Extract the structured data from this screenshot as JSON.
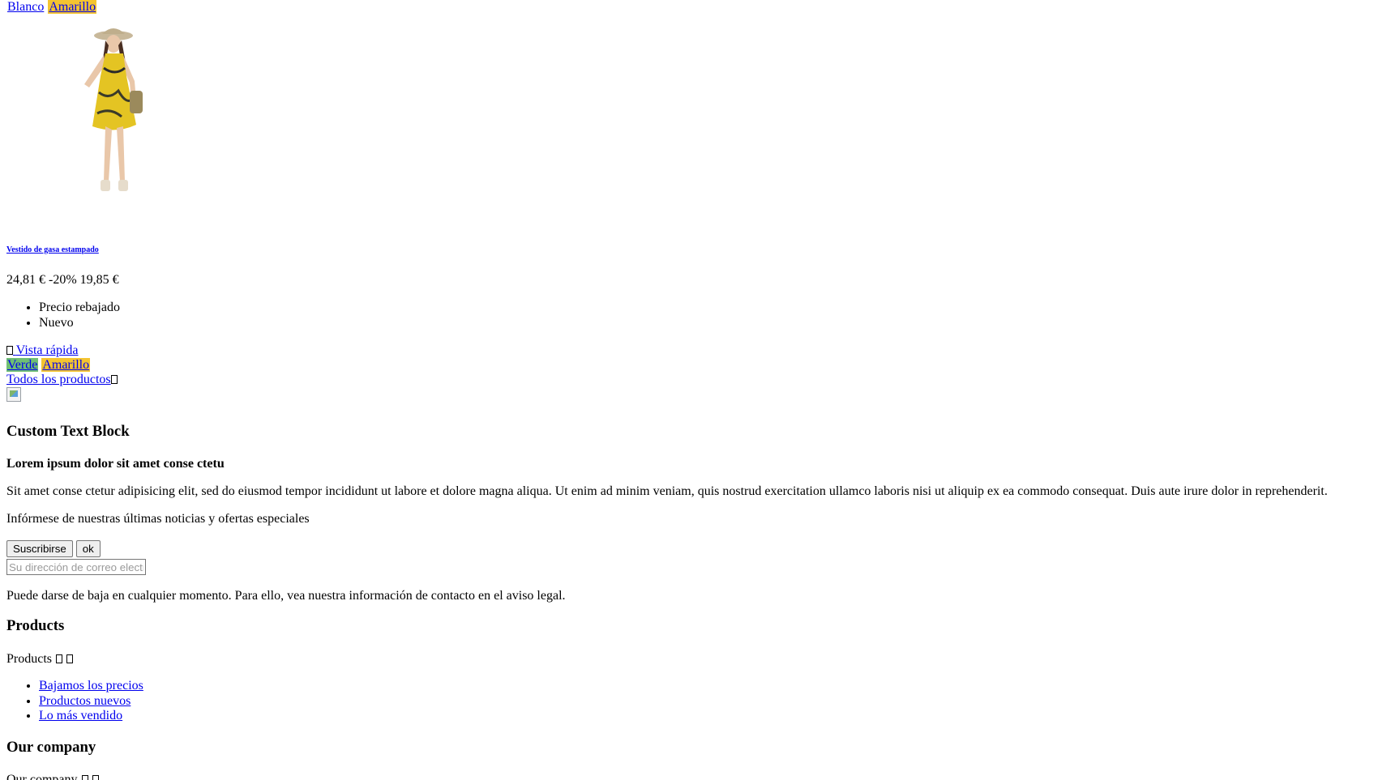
{
  "color_swatches_top": [
    "Blanco",
    "Amarillo"
  ],
  "product": {
    "image_alt": "Vestido de gasa estampado",
    "name": "Vestido de gasa estampado",
    "regular_price": "24,81 €",
    "discount": "-20%",
    "price": "19,85 €",
    "flags": [
      "Precio rebajado",
      "Nuevo"
    ],
    "quick_view": "Vista rápida",
    "color_swatches": [
      "Verde",
      "Amarillo"
    ]
  },
  "all_products_link": "Todos los productos",
  "custom_text_block": {
    "title": "Custom Text Block",
    "subtitle": "Lorem ipsum dolor sit amet conse ctetu",
    "text": "Sit amet conse ctetur adipisicing elit, sed do eiusmod tempor incididunt ut labore et dolore magna aliqua. Ut enim ad minim veniam, quis nostrud exercitation ullamco laboris nisi ut aliquip ex ea commodo consequat. Duis aute irure dolor in reprehenderit."
  },
  "newsletter": {
    "text": "Infórmese de nuestras últimas noticias y ofertas especiales",
    "subscribe_label": "Suscribirse",
    "ok_label": "ok",
    "email_placeholder": "Su dirección de correo electrónico",
    "legal": "Puede darse de baja en cualquier momento. Para ello, vea nuestra información de contacto en el aviso legal."
  },
  "footer_products": {
    "title": "Products",
    "toggle_label": "Products",
    "links": [
      "Bajamos los precios",
      "Productos nuevos",
      "Lo más vendido"
    ]
  },
  "footer_company": {
    "title": "Our company",
    "toggle_label": "Our company"
  },
  "colors": {
    "link": "#0000ee",
    "swatch_yellow": "#f4c430",
    "swatch_green": "#6fbf73"
  }
}
